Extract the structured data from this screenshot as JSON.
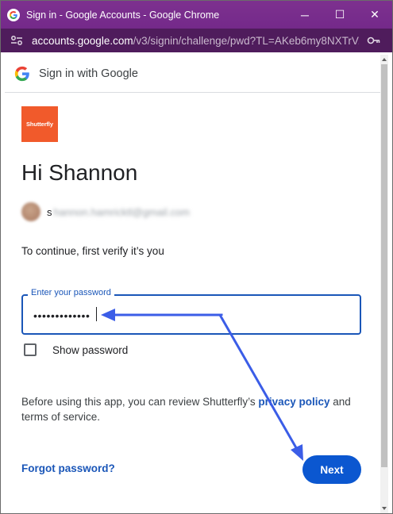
{
  "window": {
    "title": "Sign in - Google Accounts - Google Chrome",
    "controls": {
      "minimize": "─",
      "maximize": "☐",
      "close": "✕"
    }
  },
  "address_bar": {
    "url_host": "accounts.google.com",
    "url_path": "/v3/signin/challenge/pwd?TL=AKeb6my8NXTrV..."
  },
  "header": {
    "text": "Sign in with Google"
  },
  "app": {
    "logo_text": "Shutterfly",
    "logo_color": "#f15a2b"
  },
  "greeting": "Hi Shannon",
  "account": {
    "email_first_char": "s",
    "email_rest": "hannon.hamricktl@gmail.com"
  },
  "instruction": "To continue, first verify it’s you",
  "password": {
    "label": "Enter your password",
    "masked_value": "•••••••••••••"
  },
  "show_password": {
    "label": "Show password",
    "checked": false
  },
  "terms": {
    "prefix": "Before using this app, you can review Shutterfly’s ",
    "privacy_link": "privacy policy",
    "middle": " and ",
    "suffix": "terms of service."
  },
  "forgot_password": "Forgot password?",
  "next_button": "Next",
  "colors": {
    "titlebar": "#7b2d8e",
    "accent_blue": "#1a56b8",
    "next_button": "#0b57d0",
    "annotation_arrow": "#3b5de7"
  }
}
